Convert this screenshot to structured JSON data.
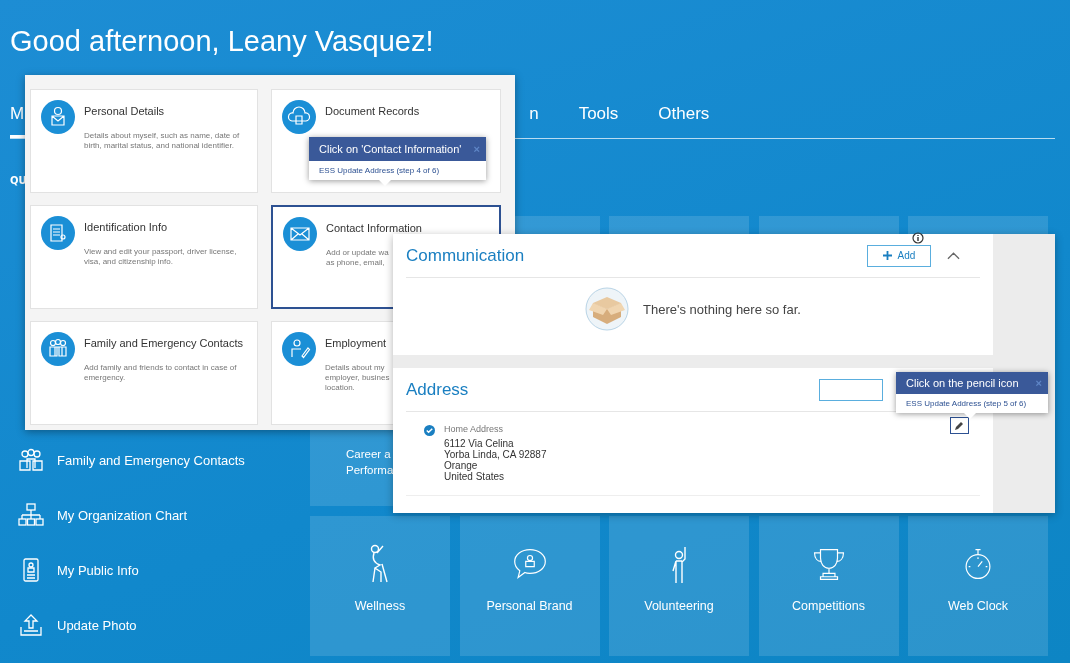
{
  "greeting": "Good afternoon, Leany Vasquez!",
  "tabs": [
    {
      "label": "M",
      "selected": true
    },
    {
      "label": "n",
      "selected": false
    },
    {
      "label": "Tools",
      "selected": false
    },
    {
      "label": "Others",
      "selected": false
    }
  ],
  "quick_actions": {
    "heading": "QU",
    "items": [
      {
        "label": "Family and Emergency Contacts",
        "kind": "family"
      },
      {
        "label": "My Organization Chart",
        "kind": "org"
      },
      {
        "label": "My Public Info",
        "kind": "badge"
      },
      {
        "label": "Update Photo",
        "kind": "upload"
      }
    ]
  },
  "tile_rows": [
    [
      {
        "label": "Career a\nPerforma",
        "kind": "text"
      }
    ],
    [
      {
        "label": "Wellness",
        "kind": "wellness"
      },
      {
        "label": "Personal Brand",
        "kind": "brand"
      },
      {
        "label": "Volunteering",
        "kind": "volunteer"
      },
      {
        "label": "Competitions",
        "kind": "trophy"
      },
      {
        "label": "Web Clock",
        "kind": "clock"
      }
    ]
  ],
  "profile_cards": [
    {
      "title": "Personal Details",
      "description": "Details about myself, such as name, date of\nbirth, marital status, and national identifier.",
      "kind": "person",
      "selected": false
    },
    {
      "title": "Document Records",
      "kind": "cloud",
      "selected": false
    },
    {
      "title": "Identification Info",
      "description": "View and edit your passport, driver license,\nvisa, and citizenship info.",
      "kind": "id",
      "selected": false
    },
    {
      "title": "Contact Information",
      "description": "Add or update wa\nas phone, email,",
      "kind": "mail",
      "selected": true
    },
    {
      "title": "Family and Emergency Contacts",
      "description": "Add family and friends to contact in case of\nemergency.",
      "kind": "family",
      "selected": false
    },
    {
      "title": "Employment",
      "description": "Details about my\nemployer, busines\nlocation.",
      "kind": "sign",
      "selected": false
    }
  ],
  "guides": [
    {
      "title": "Click on 'Contact Information'",
      "close": "×",
      "step": "ESS Update Address (step 4 of 6)"
    },
    {
      "title": "Click on the pencil icon",
      "close": "×",
      "step": "ESS Update Address (step 5 of 6)"
    }
  ],
  "communication": {
    "title": "Communication",
    "add_label": "Add",
    "expanded": true,
    "empty_text": "There's nothing here so far."
  },
  "address": {
    "title": "Address",
    "items": [
      {
        "type": "Home Address",
        "primary": true,
        "lines": [
          "6112 Via Celina",
          "Yorba Linda, CA 92887",
          "Orange",
          "United States"
        ]
      }
    ]
  }
}
